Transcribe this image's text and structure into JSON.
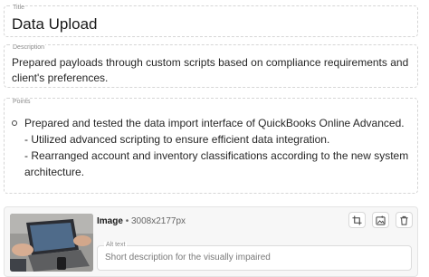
{
  "title_field": {
    "label": "Title",
    "value": "Data Upload"
  },
  "description_field": {
    "label": "Description",
    "value": "Prepared payloads through custom scripts based on compliance requirements and client's preferences."
  },
  "points_field": {
    "label": "Points",
    "items": [
      "Prepared and tested the data import interface of QuickBooks Online Advanced.",
      "- Utilized advanced scripting to ensure efficient data integration.",
      "- Rearranged account and inventory classifications according to the new system architecture."
    ]
  },
  "image_card": {
    "label": "Image",
    "separator": "•",
    "dimensions": "3008x2177px",
    "actions": {
      "crop_icon": "crop-icon",
      "replace_icon": "image-replace-icon",
      "delete_icon": "trash-icon"
    },
    "alt_text": {
      "label": "Alt text",
      "value": "",
      "placeholder": "Short description for the visually impaired"
    }
  }
}
